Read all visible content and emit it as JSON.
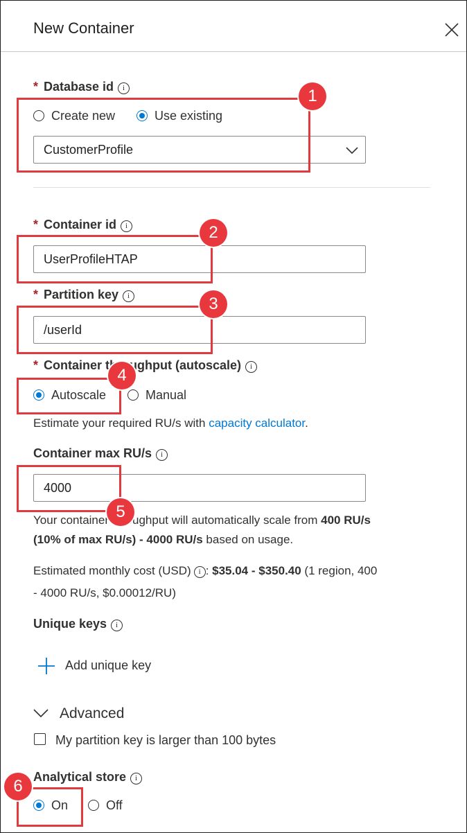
{
  "panel": {
    "title": "New Container"
  },
  "database": {
    "label": "Database id",
    "required_mark": "*",
    "info": "i",
    "options": [
      "Create new",
      "Use existing"
    ],
    "selected_option": "Use existing",
    "value": "CustomerProfile"
  },
  "container": {
    "label": "Container id",
    "required_mark": "*",
    "info": "i",
    "value": "UserProfileHTAP"
  },
  "partition": {
    "label": "Partition key",
    "required_mark": "*",
    "info": "i",
    "value": "/userId"
  },
  "throughput": {
    "label": "Container throughput (autoscale)",
    "required_mark": "*",
    "info": "i",
    "options": [
      "Autoscale",
      "Manual"
    ],
    "selected_option": "Autoscale",
    "estimate_text": "Estimate your required RU/s with ",
    "estimate_link": "capacity calculator",
    "estimate_end": "."
  },
  "max_ru": {
    "label": "Container max RU/s",
    "info": "i",
    "value": "4000",
    "scale_text_1": "Your container throughput will automatically scale from ",
    "scale_bold_1": "400 RU/s",
    "scale_bold_2": "(10% of max RU/s) - 4000 RU/s",
    "scale_text_2": " based on usage.",
    "cost_label": "Estimated monthly cost (USD)",
    "cost_info": "i",
    "cost_colon": ": ",
    "cost_value": "$35.04 - $350.40",
    "cost_detail_1": " (1 region, 400",
    "cost_detail_2": "- 4000 RU/s, $0.00012/RU)"
  },
  "unique_keys": {
    "label": "Unique keys",
    "info": "i",
    "add_label": "Add unique key"
  },
  "advanced": {
    "label": "Advanced",
    "checkbox_label": "My partition key is larger than 100 bytes",
    "checked": false
  },
  "analytical": {
    "label": "Analytical store",
    "info": "i",
    "options": [
      "On",
      "Off"
    ],
    "selected_option": "On"
  },
  "callouts": [
    "1",
    "2",
    "3",
    "4",
    "5",
    "6"
  ],
  "colors": {
    "accent": "#0078d4",
    "callout": "#e0393e",
    "required": "#a4262c"
  }
}
